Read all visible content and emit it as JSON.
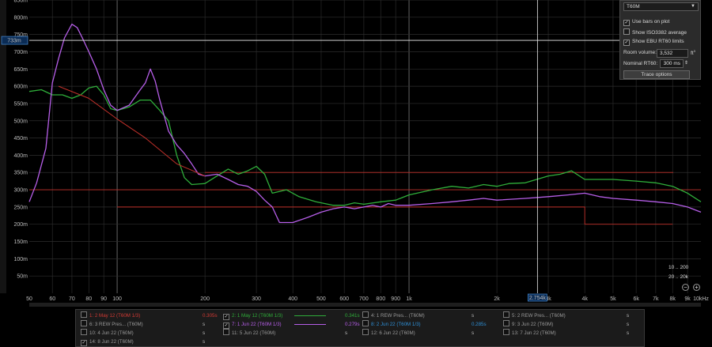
{
  "chart_data": {
    "type": "line",
    "xscale": "log",
    "xlim": [
      50,
      10000
    ],
    "ylim": [
      0,
      850
    ],
    "yunit": "ms",
    "y_ticks": [
      "850m",
      "800m",
      "750m",
      "700m",
      "650m",
      "600m",
      "550m",
      "500m",
      "450m",
      "400m",
      "350m",
      "300m",
      "250m",
      "200m",
      "150m",
      "100m",
      "50m"
    ],
    "x_ticks": [
      "50",
      "60",
      "70",
      "80",
      "90",
      "100",
      "200",
      "300",
      "400",
      "500",
      "600",
      "700",
      "800",
      "900",
      "1k",
      "2k",
      "3k",
      "4k",
      "5k",
      "6k",
      "7k",
      "8k",
      "9k",
      "10kHz"
    ],
    "cursor": {
      "x_label": "2.754k",
      "y_label": "733m"
    },
    "series": [
      {
        "name": "2: 1 May 12 (T60M 1/3)",
        "color": "#2fae3a",
        "points": [
          [
            50,
            585
          ],
          [
            55,
            590
          ],
          [
            60,
            575
          ],
          [
            65,
            575
          ],
          [
            70,
            565
          ],
          [
            75,
            575
          ],
          [
            80,
            595
          ],
          [
            85,
            600
          ],
          [
            90,
            575
          ],
          [
            95,
            535
          ],
          [
            100,
            530
          ],
          [
            110,
            540
          ],
          [
            120,
            560
          ],
          [
            130,
            560
          ],
          [
            140,
            530
          ],
          [
            150,
            500
          ],
          [
            160,
            400
          ],
          [
            170,
            335
          ],
          [
            180,
            315
          ],
          [
            200,
            318
          ],
          [
            220,
            340
          ],
          [
            240,
            360
          ],
          [
            260,
            345
          ],
          [
            280,
            355
          ],
          [
            300,
            368
          ],
          [
            320,
            345
          ],
          [
            340,
            290
          ],
          [
            380,
            300
          ],
          [
            420,
            280
          ],
          [
            480,
            265
          ],
          [
            550,
            255
          ],
          [
            600,
            255
          ],
          [
            650,
            262
          ],
          [
            700,
            258
          ],
          [
            800,
            265
          ],
          [
            900,
            270
          ],
          [
            1000,
            285
          ],
          [
            1200,
            300
          ],
          [
            1400,
            310
          ],
          [
            1600,
            305
          ],
          [
            1800,
            315
          ],
          [
            2000,
            310
          ],
          [
            2200,
            318
          ],
          [
            2500,
            320
          ],
          [
            3000,
            340
          ],
          [
            3300,
            345
          ],
          [
            3600,
            355
          ],
          [
            4000,
            330
          ],
          [
            5000,
            330
          ],
          [
            6000,
            325
          ],
          [
            7000,
            320
          ],
          [
            8000,
            310
          ],
          [
            9000,
            290
          ],
          [
            10000,
            265
          ]
        ]
      },
      {
        "name": "7: 1 Jun 22 (T60M 1/3)",
        "color": "#b65ee8",
        "points": [
          [
            50,
            265
          ],
          [
            53,
            320
          ],
          [
            57,
            420
          ],
          [
            60,
            610
          ],
          [
            63,
            680
          ],
          [
            66,
            740
          ],
          [
            70,
            780
          ],
          [
            73,
            770
          ],
          [
            76,
            740
          ],
          [
            80,
            700
          ],
          [
            85,
            650
          ],
          [
            90,
            590
          ],
          [
            95,
            545
          ],
          [
            100,
            530
          ],
          [
            110,
            545
          ],
          [
            120,
            590
          ],
          [
            125,
            610
          ],
          [
            130,
            650
          ],
          [
            135,
            615
          ],
          [
            140,
            560
          ],
          [
            150,
            470
          ],
          [
            160,
            430
          ],
          [
            170,
            405
          ],
          [
            180,
            375
          ],
          [
            190,
            345
          ],
          [
            200,
            340
          ],
          [
            220,
            345
          ],
          [
            240,
            330
          ],
          [
            260,
            315
          ],
          [
            280,
            310
          ],
          [
            300,
            295
          ],
          [
            320,
            270
          ],
          [
            340,
            250
          ],
          [
            360,
            205
          ],
          [
            380,
            205
          ],
          [
            400,
            205
          ],
          [
            450,
            220
          ],
          [
            500,
            235
          ],
          [
            550,
            245
          ],
          [
            600,
            250
          ],
          [
            650,
            245
          ],
          [
            700,
            250
          ],
          [
            750,
            255
          ],
          [
            800,
            250
          ],
          [
            850,
            260
          ],
          [
            900,
            255
          ],
          [
            1000,
            255
          ],
          [
            1200,
            260
          ],
          [
            1400,
            265
          ],
          [
            1600,
            270
          ],
          [
            1800,
            275
          ],
          [
            2000,
            270
          ],
          [
            2500,
            275
          ],
          [
            3000,
            280
          ],
          [
            3500,
            285
          ],
          [
            4000,
            290
          ],
          [
            4500,
            280
          ],
          [
            5000,
            275
          ],
          [
            6000,
            270
          ],
          [
            7000,
            265
          ],
          [
            8000,
            260
          ],
          [
            9000,
            250
          ],
          [
            10000,
            235
          ]
        ]
      },
      {
        "name": "ISO3382 average",
        "color": "#c0302a",
        "points": [
          [
            63,
            600
          ],
          [
            80,
            565
          ],
          [
            100,
            505
          ],
          [
            125,
            450
          ],
          [
            160,
            375
          ],
          [
            200,
            340
          ]
        ]
      }
    ],
    "limits": {
      "color": "#c0302a",
      "nominal_rt60": 300,
      "upper": 350,
      "lower": 250,
      "lower_hf": 200
    }
  },
  "panel": {
    "dropdown": "T60M",
    "use_bars_on_plot": "Use bars on plot",
    "show_iso": "Show ISO3382 average",
    "show_ebu": "Show EBU RT60 limits",
    "room_volume_label": "Room volume:",
    "room_volume_value": "3,532",
    "room_volume_unit": "ft",
    "nominal_label": "Nominal RT60:",
    "nominal_value": "300 ms",
    "trace_options": "Trace options"
  },
  "legend": {
    "rows": [
      [
        {
          "label": "1: 2 May 12 (T60M 1/3)",
          "value": "0.305s",
          "color": "#d23a34",
          "checked": false
        },
        {
          "label": "2: 1 May 12 (T60M 1/3)",
          "value": "0.341s",
          "color": "#2fae3a",
          "checked": true,
          "line": true
        },
        {
          "label": "4: 1 REW Pres... (T60M)",
          "value": "s",
          "color": "#9a9a9a",
          "checked": false
        },
        {
          "label": "5: 2 REW Pres... (T60M)",
          "value": "s",
          "color": "#9a9a9a",
          "checked": false
        }
      ],
      [
        {
          "label": "6: 3 REW Pres... (T60M)",
          "value": "s",
          "color": "#9a9a9a",
          "checked": false
        },
        {
          "label": "7: 1 Jun 22 (T60M 1/3)",
          "value": "0.279s",
          "color": "#b65ee8",
          "checked": true,
          "line": true
        },
        {
          "label": "8: 2 Jun 22 (T60M 1/3)",
          "value": "0.285s",
          "color": "#2e8fd6",
          "checked": false
        },
        {
          "label": "9: 3 Jun 22 (T60M)",
          "value": "s",
          "color": "#9a9a9a",
          "checked": false
        }
      ],
      [
        {
          "label": "10: 4 Jun 22 (T60M)",
          "value": "s",
          "color": "#9a9a9a",
          "checked": false
        },
        {
          "label": "11: 5 Jun 22 (T60M)",
          "value": "s",
          "color": "#9a9a9a",
          "checked": false
        },
        {
          "label": "12: 6 Jun 22 (T60M)",
          "value": "s",
          "color": "#9a9a9a",
          "checked": false
        },
        {
          "label": "13: 7 Jun 22 (T60M)",
          "value": "s",
          "color": "#9a9a9a",
          "checked": false
        }
      ],
      [
        {
          "label": "14: 8 Jun 22 (T60M)",
          "value": "s",
          "color": "#9a9a9a",
          "checked": true
        }
      ]
    ]
  },
  "range": {
    "line1": "10 .. 200",
    "line2": "20 .. 20k"
  },
  "zoom": {
    "out_icon": "zoom-out-icon",
    "in_icon": "zoom-in-icon"
  }
}
